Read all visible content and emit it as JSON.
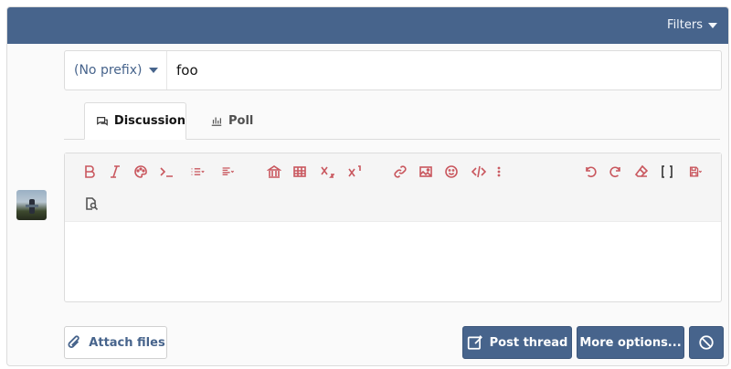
{
  "header": {
    "filters_label": "Filters"
  },
  "title_row": {
    "prefix_label": "(No prefix)",
    "title_value": "foo"
  },
  "tabs": [
    {
      "label": "Discussion",
      "icon": "comments-icon",
      "active": true
    },
    {
      "label": "Poll",
      "icon": "bar-chart-icon",
      "active": false
    }
  ],
  "toolbar": {
    "buttons": [
      "bold",
      "italic",
      "text-color",
      "inline-code",
      "list",
      "align",
      "bank",
      "table",
      "subscript",
      "superscript",
      "link",
      "image",
      "emoji",
      "code",
      "more",
      "undo",
      "redo",
      "remove-format",
      "bb-code",
      "drafts",
      "preview"
    ]
  },
  "actions": {
    "attach_label": "Attach files",
    "post_label": "Post thread",
    "more_label": "More options..."
  },
  "colors": {
    "accent": "#47648c",
    "toolbar_icon": "#c9575e"
  }
}
